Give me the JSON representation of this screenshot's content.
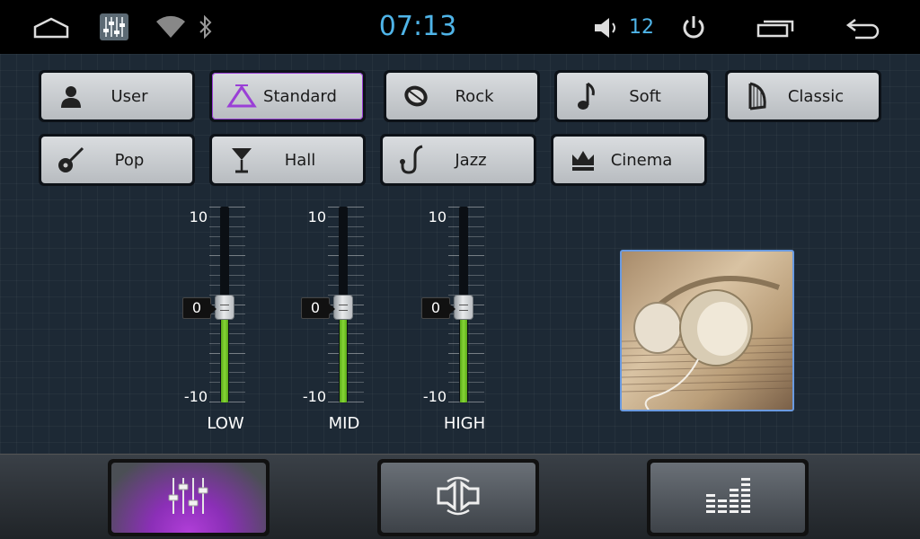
{
  "status_bar": {
    "time": "07:13",
    "volume": "12",
    "icons": [
      "home-icon",
      "equalizer-app-icon",
      "wifi-icon",
      "bluetooth-icon",
      "speaker-icon",
      "power-icon",
      "recent-apps-icon",
      "back-icon"
    ]
  },
  "presets": [
    {
      "label": "User",
      "icon": "user-icon"
    },
    {
      "label": "Standard",
      "icon": "triangle-icon"
    },
    {
      "label": "Rock",
      "icon": "drum-icon"
    },
    {
      "label": "Soft",
      "icon": "music-note-icon"
    },
    {
      "label": "Classic",
      "icon": "harp-icon"
    },
    {
      "label": "Pop",
      "icon": "guitar-icon"
    },
    {
      "label": "Hall",
      "icon": "cocktail-icon"
    },
    {
      "label": "Jazz",
      "icon": "saxophone-icon"
    },
    {
      "label": "Cinema",
      "icon": "crown-icon"
    }
  ],
  "active_preset": "Standard",
  "equalizer": {
    "scale_max": "10",
    "scale_min": "-10",
    "bands": [
      {
        "label": "LOW",
        "value": "0"
      },
      {
        "label": "MID",
        "value": "0"
      },
      {
        "label": "HIGH",
        "value": "0"
      }
    ]
  },
  "bottom_tabs": [
    {
      "name": "equalizer-tab",
      "icon": "sliders-icon",
      "active": true
    },
    {
      "name": "balance-tab",
      "icon": "speaker-balance-icon",
      "active": false
    },
    {
      "name": "spectrum-tab",
      "icon": "spectrum-bars-icon",
      "active": false
    }
  ],
  "colors": {
    "accent": "#4fb4e8",
    "active_purple": "#9a3fd6",
    "slider_green": "#7cc92e"
  }
}
